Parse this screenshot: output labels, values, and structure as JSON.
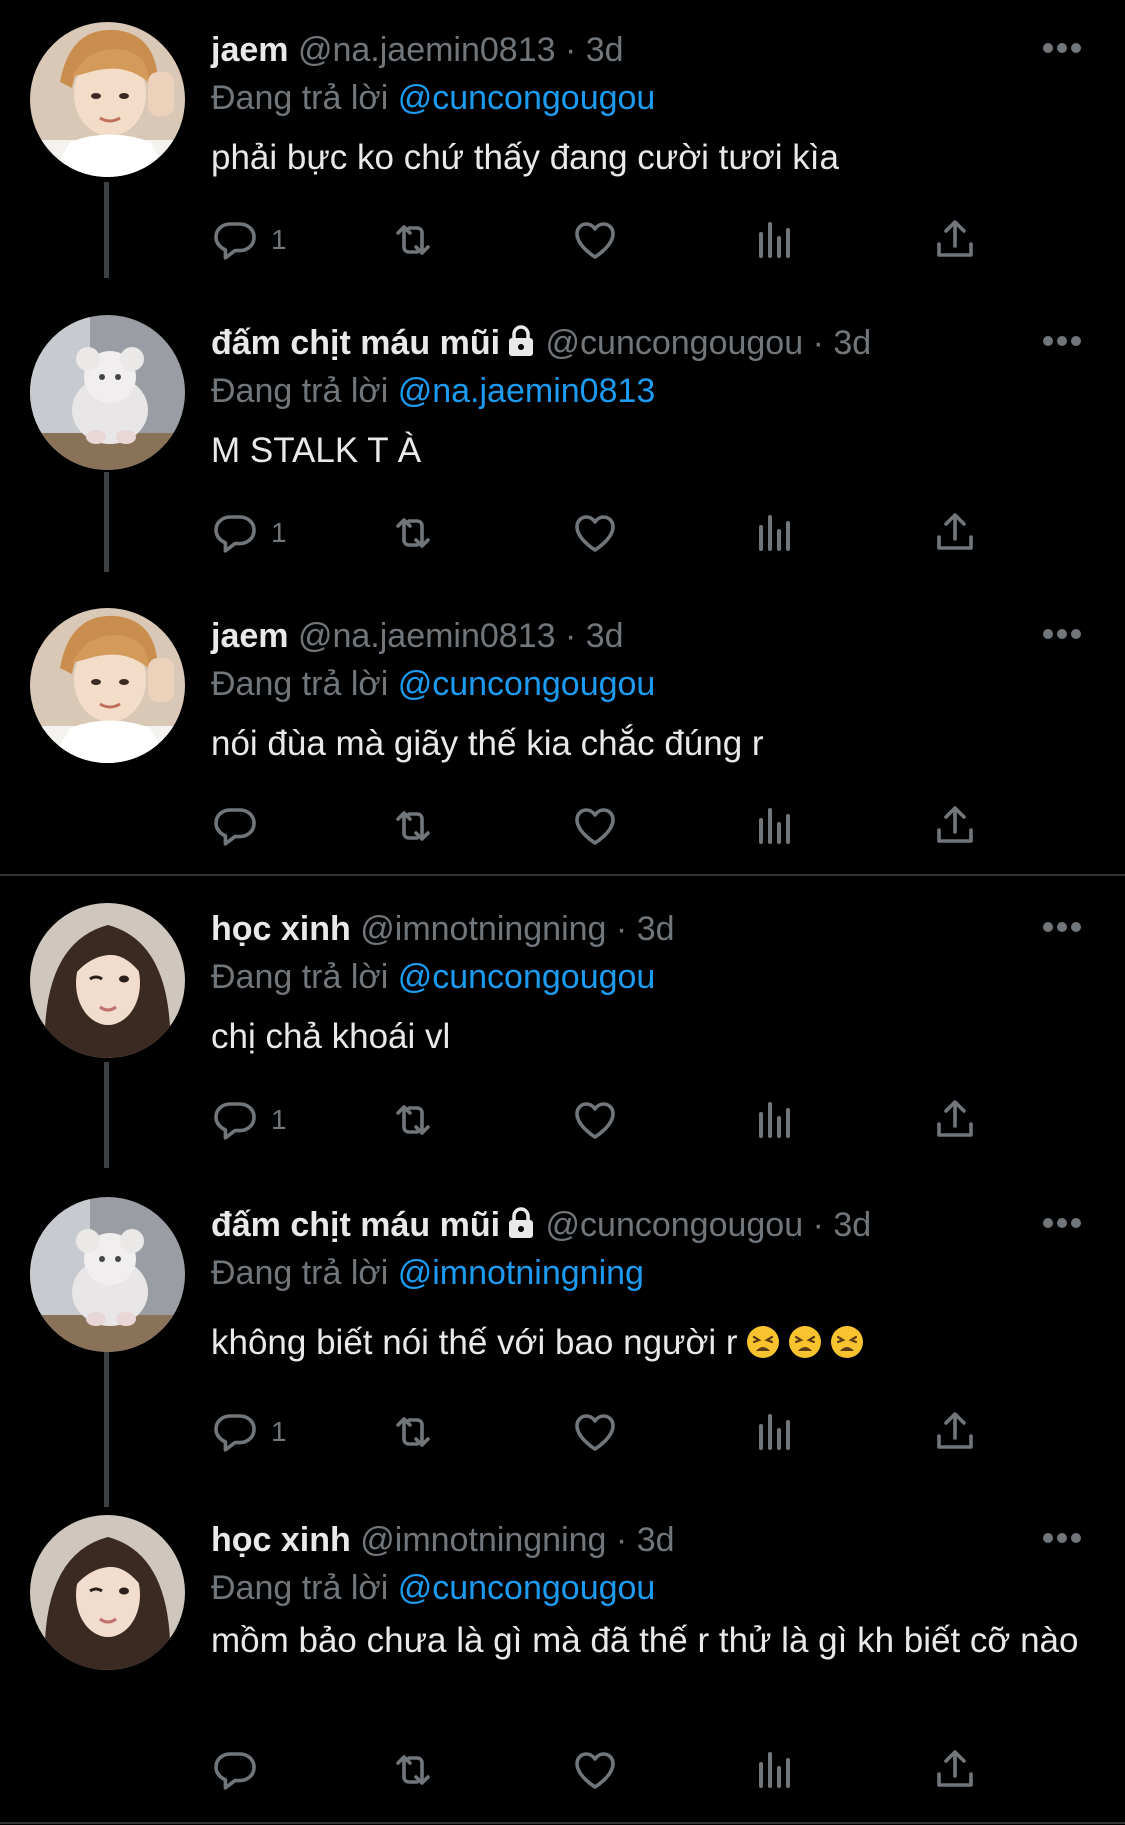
{
  "tweets": [
    {
      "name": "jaem",
      "handle": "@na.jaemin0813",
      "separator": "·",
      "time": "3d",
      "reply_prefix": "Đang trả lời",
      "reply_to": "@cuncongougou",
      "text": "phải bực ko chứ thấy đang cười tươi kìa",
      "reply_count": "1",
      "avatar": "jaem-avatar"
    },
    {
      "name": "đấm chịt máu mũi",
      "handle": "@cuncongougou",
      "separator": "·",
      "time": "3d",
      "reply_prefix": "Đang trả lời",
      "reply_to": "@na.jaemin0813",
      "text": "M STALK T À",
      "reply_count": "1",
      "avatar": "plush-avatar"
    },
    {
      "name": "jaem",
      "handle": "@na.jaemin0813",
      "separator": "·",
      "time": "3d",
      "reply_prefix": "Đang trả lời",
      "reply_to": "@cuncongougou",
      "text": "nói đùa mà giãy thế kia chắc đúng r",
      "reply_count": "",
      "avatar": "jaem-avatar"
    },
    {
      "name": "học xinh",
      "handle": "@imnotningning",
      "separator": "·",
      "time": "3d",
      "reply_prefix": "Đang trả lời",
      "reply_to": "@cuncongougou",
      "text": "chị chả khoái vl",
      "reply_count": "1",
      "avatar": "girl-avatar"
    },
    {
      "name": "đấm chịt máu mũi",
      "handle": "@cuncongougou",
      "separator": "·",
      "time": "3d",
      "reply_prefix": "Đang trả lời",
      "reply_to": "@imnotningning",
      "text": "không biết nói thế với bao người r",
      "reply_count": "1",
      "avatar": "plush-avatar"
    },
    {
      "name": "học xinh",
      "handle": "@imnotningning",
      "separator": "·",
      "time": "3d",
      "reply_prefix": "Đang trả lời",
      "reply_to": "@cuncongougou",
      "text": "mồm bảo chưa là gì mà đã thế r thử là gì kh biết cỡ nào",
      "reply_count": "",
      "avatar": "girl-avatar"
    }
  ],
  "icons": {
    "reply": "reply-icon",
    "retweet": "retweet-icon",
    "like": "heart-icon",
    "views": "views-icon",
    "share": "share-icon",
    "more": "more-icon",
    "lock": "lock-icon",
    "emoji": "tired-face-emoji"
  },
  "colors": {
    "background": "#000000",
    "text": "#e7e9ea",
    "muted": "#71767b",
    "link": "#1d9bf0",
    "thread": "#3e4144",
    "divider": "#2f3336"
  }
}
